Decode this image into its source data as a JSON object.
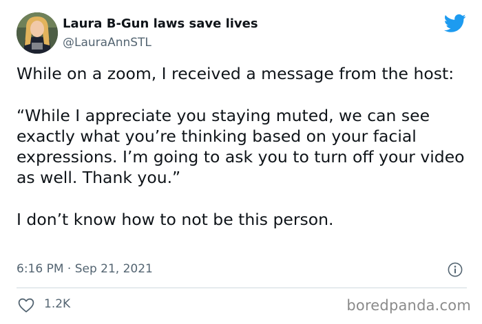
{
  "author": {
    "display_name": "Laura B-Gun laws save lives",
    "handle": "@LauraAnnSTL"
  },
  "icons": {
    "avatar": "profile-photo",
    "brand": "twitter-bird-icon",
    "info": "info-icon",
    "like": "heart-icon"
  },
  "colors": {
    "brand": "#1d9bf0",
    "text": "#0f1419",
    "secondary": "#536471",
    "divider": "#cfd9de"
  },
  "tweet": {
    "paragraphs": [
      "While on a zoom, I received a message from the host:",
      "“While I appreciate you staying muted, we can see exactly what you’re thinking based on your facial expressions. I’m going to ask you to turn off your video as well. Thank you.”",
      "I don’t know how to not be this person."
    ],
    "timestamp": "6:16 PM · Sep 21, 2021",
    "like_count": "1.2K"
  },
  "watermark": "boredpanda.com"
}
